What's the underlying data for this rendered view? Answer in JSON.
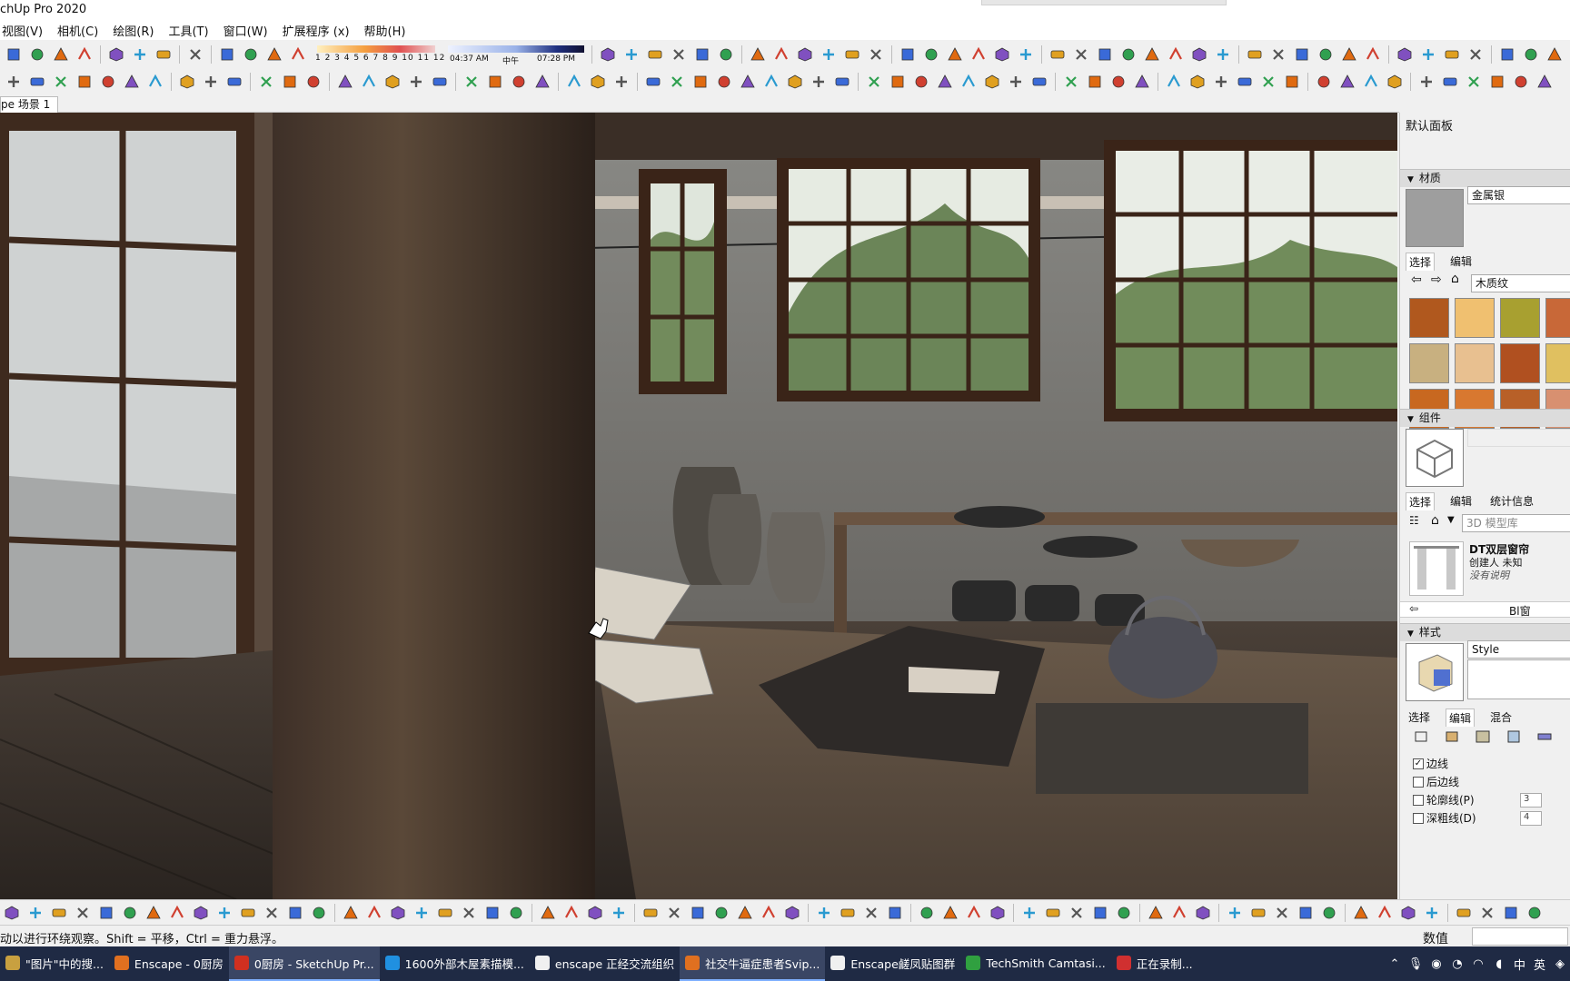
{
  "window": {
    "title": "chUp Pro 2020"
  },
  "menu": [
    "视图(V)",
    "相机(C)",
    "绘图(R)",
    "工具(T)",
    "窗口(W)",
    "扩展程序 (x)",
    "帮助(H)"
  ],
  "shadow": {
    "month_ticks": "1 2 3 4 5 6 7 8 9 10 11 12",
    "time_start": "04:37 AM",
    "time_mid": "中午",
    "time_end": "07:28 PM"
  },
  "scene_tab": "pe 场景 1",
  "panel": {
    "title": "默认面板",
    "materials": {
      "header": "材质",
      "name": "金属银",
      "tabs": [
        "选择",
        "编辑"
      ],
      "library": "木质纹",
      "swatch_colors": [
        "#b0581e",
        "#f0c070",
        "#a8a030",
        "#c86838",
        "#c8b080",
        "#e8c090",
        "#b05020",
        "#e0c060",
        "#c86820",
        "#d87830",
        "#b86028",
        "#d89070"
      ]
    },
    "components": {
      "header": "组件",
      "tabs": [
        "选择",
        "编辑",
        "统计信息"
      ],
      "search_placeholder": "3D 模型库",
      "item_title": "DT双层窗帘",
      "item_creator": "创建人 未知",
      "item_desc": "没有说明",
      "nav_label": "Bl窗"
    },
    "styles": {
      "header": "样式",
      "name": "Style",
      "tabs": [
        "选择",
        "编辑",
        "混合"
      ],
      "options": [
        {
          "label": "边线",
          "checked": true,
          "value": ""
        },
        {
          "label": "后边线",
          "checked": false,
          "value": ""
        },
        {
          "label": "轮廓线(P)",
          "checked": false,
          "value": "3"
        },
        {
          "label": "深粗线(D)",
          "checked": false,
          "value": "4"
        }
      ]
    }
  },
  "status": {
    "hint": "动以进行环绕观察。Shift = 平移，Ctrl = 重力悬浮。",
    "measurements_label": "数值"
  },
  "taskbar": {
    "items": [
      {
        "label": "\"图片\"中的搜...",
        "color": "#c8a040",
        "active": false
      },
      {
        "label": "Enscape - 0厨房",
        "color": "#e07020",
        "active": false
      },
      {
        "label": "0厨房 - SketchUp Pr...",
        "color": "#d03020",
        "active": true
      },
      {
        "label": "1600外部木屋素描模...",
        "color": "#2090e0",
        "active": false
      },
      {
        "label": "enscape 正经交流组织",
        "color": "#f0f0f0",
        "active": false
      },
      {
        "label": "社交牛逼症患者Svip...",
        "color": "#e07020",
        "active": true
      },
      {
        "label": "Enscape鹾凤贴图群",
        "color": "#f0f0f0",
        "active": false
      },
      {
        "label": "TechSmith Camtasi...",
        "color": "#30a040",
        "active": false
      },
      {
        "label": "正在录制...",
        "color": "#d03030",
        "active": false
      }
    ],
    "ime": "中",
    "tray_extra": "英"
  }
}
